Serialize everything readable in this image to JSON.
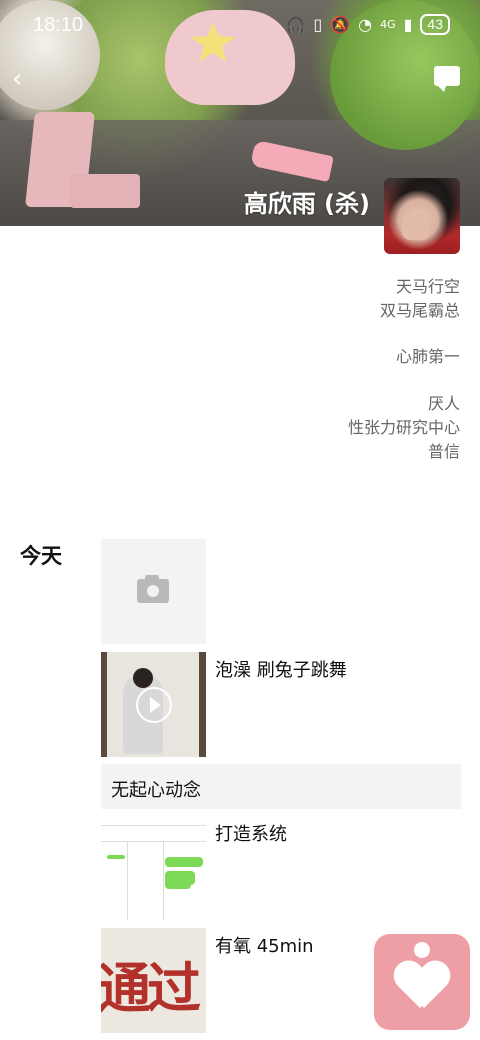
{
  "status_bar": {
    "time": "18:10",
    "network": "4G",
    "battery": "43",
    "icons": [
      "headphones-icon",
      "battery-saver-icon",
      "mute-icon",
      "wifi-icon",
      "signal-icon"
    ]
  },
  "header": {
    "back_icon": "chevron-left-icon",
    "message_icon": "comment-icon",
    "username": "高欣雨 (杀)"
  },
  "signature": {
    "group1": [
      "天马行空",
      "双马尾霸总"
    ],
    "group2": [
      "心肺第一"
    ],
    "group3": [
      "厌人",
      "性张力研究中心",
      "普信"
    ]
  },
  "feed": {
    "day_label": "今天",
    "camera_icon": "camera-icon",
    "posts": [
      {
        "type": "video",
        "caption": "泡澡 刷兔子跳舞"
      },
      {
        "type": "text",
        "caption": "无起心动念"
      },
      {
        "type": "image",
        "caption": "打造系统"
      },
      {
        "type": "image",
        "caption": "有氧 45min"
      }
    ]
  },
  "fab": {
    "icon": "heart-icon"
  },
  "colors": {
    "fab": "#ee9fa5",
    "text_post_bg": "#f3f3f3",
    "signature_text": "#666666"
  }
}
